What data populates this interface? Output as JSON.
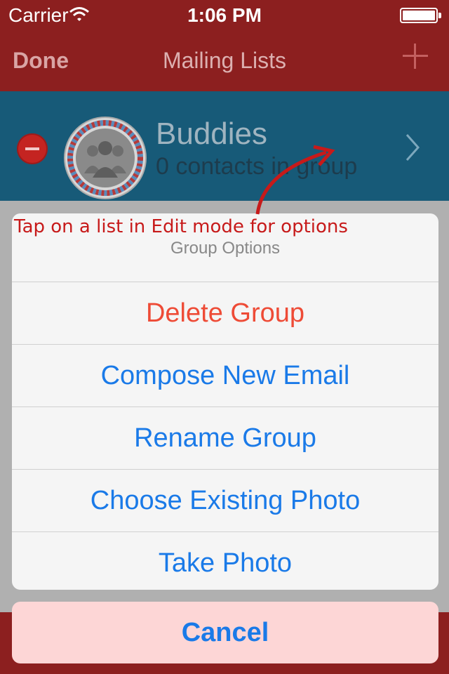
{
  "status_bar": {
    "carrier": "Carrier",
    "time": "1:06 PM"
  },
  "nav": {
    "done": "Done",
    "title": "Mailing Lists"
  },
  "group_row": {
    "name": "Buddies",
    "subtitle": "0 contacts in group"
  },
  "annotation": "Tap on a list in Edit mode for options",
  "action_sheet": {
    "title": "Group Options",
    "options": [
      "Delete Group",
      "Compose New Email",
      "Rename Group",
      "Choose Existing Photo",
      "Take Photo"
    ],
    "cancel": "Cancel"
  },
  "colors": {
    "bar": "#8c1f1f",
    "row": "#175a78",
    "action_blue": "#1a7ae8",
    "destructive": "#ee4b36"
  }
}
